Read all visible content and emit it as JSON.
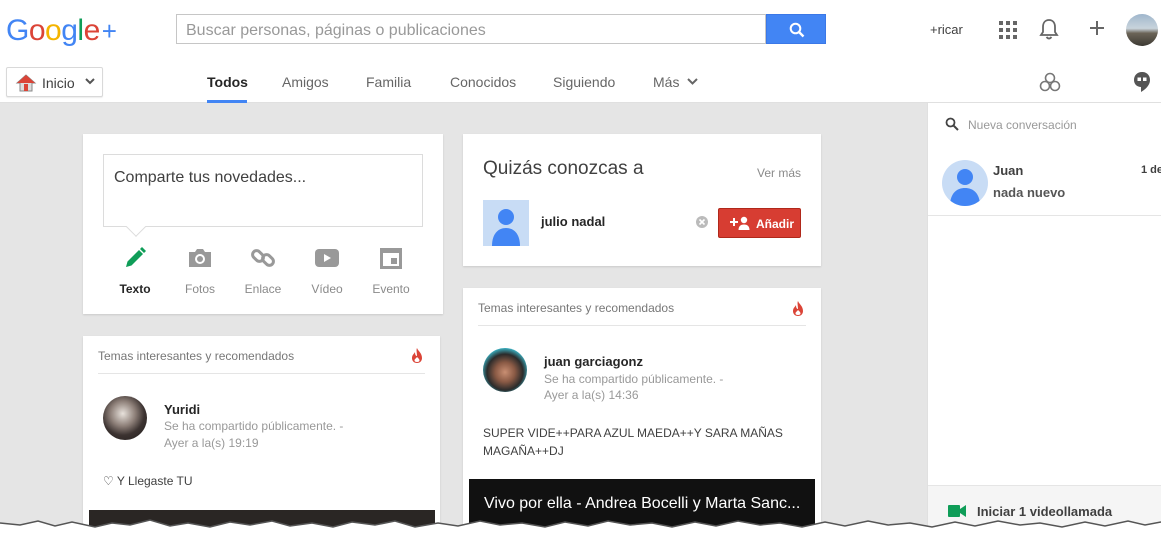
{
  "header": {
    "logo_text": {
      "g1": "G",
      "o1": "o",
      "o2": "o",
      "g2": "g",
      "l": "l",
      "e": "e",
      "plus": "+"
    },
    "search_placeholder": "Buscar personas, páginas o publicaciones",
    "user_link": "+ricar",
    "icons": [
      "search-icon",
      "apps-grid-icon",
      "bell-icon",
      "plus-icon",
      "avatar"
    ]
  },
  "nav": {
    "home_label": "Inicio",
    "tabs": [
      {
        "label": "Todos",
        "active": true
      },
      {
        "label": "Amigos"
      },
      {
        "label": "Familia"
      },
      {
        "label": "Conocidos"
      },
      {
        "label": "Siguiendo"
      },
      {
        "label": "Más"
      }
    ]
  },
  "share": {
    "prompt": "Comparte tus novedades...",
    "options": [
      {
        "label": "Texto",
        "icon": "pencil-icon",
        "selected": true
      },
      {
        "label": "Fotos",
        "icon": "camera-icon"
      },
      {
        "label": "Enlace",
        "icon": "link-icon"
      },
      {
        "label": "Vídeo",
        "icon": "video-icon"
      },
      {
        "label": "Evento",
        "icon": "calendar-icon"
      }
    ]
  },
  "recommended_left": {
    "title": "Temas interesantes y recomendados",
    "post": {
      "author": "Yuridi",
      "visibility": "Se ha compartido públicamente.  -",
      "time": "Ayer a la(s) 19:19",
      "text": "♡ Y Llegaste TU"
    }
  },
  "people": {
    "title": "Quizás conozcas a",
    "see_more": "Ver más",
    "person_name": "julio nadal",
    "add_label": "Añadir"
  },
  "recommended_right": {
    "title": "Temas interesantes y recomendados",
    "post": {
      "author": "juan garciagonz",
      "visibility": "Se ha compartido públicamente.  -",
      "time": "Ayer a la(s) 14:36",
      "text_line1": "SUPER VIDE++PARA AZUL MAEDA++Y SARA MAÑAS",
      "text_line2": "MAGAÑA++DJ",
      "video_title": "Vivo por ella - Andrea Bocelli y Marta Sanc..."
    }
  },
  "chat": {
    "search_placeholder": "Nueva conversación",
    "conversation": {
      "name": "Juan",
      "message": "nada nuevo",
      "time": "1 de"
    },
    "video_call_label": "Iniciar 1 videollamada"
  },
  "colors": {
    "google_blue": "#4285f4",
    "add_red": "#d73d32",
    "fire_red": "#db4437",
    "hangouts_green": "#0f9d58"
  }
}
